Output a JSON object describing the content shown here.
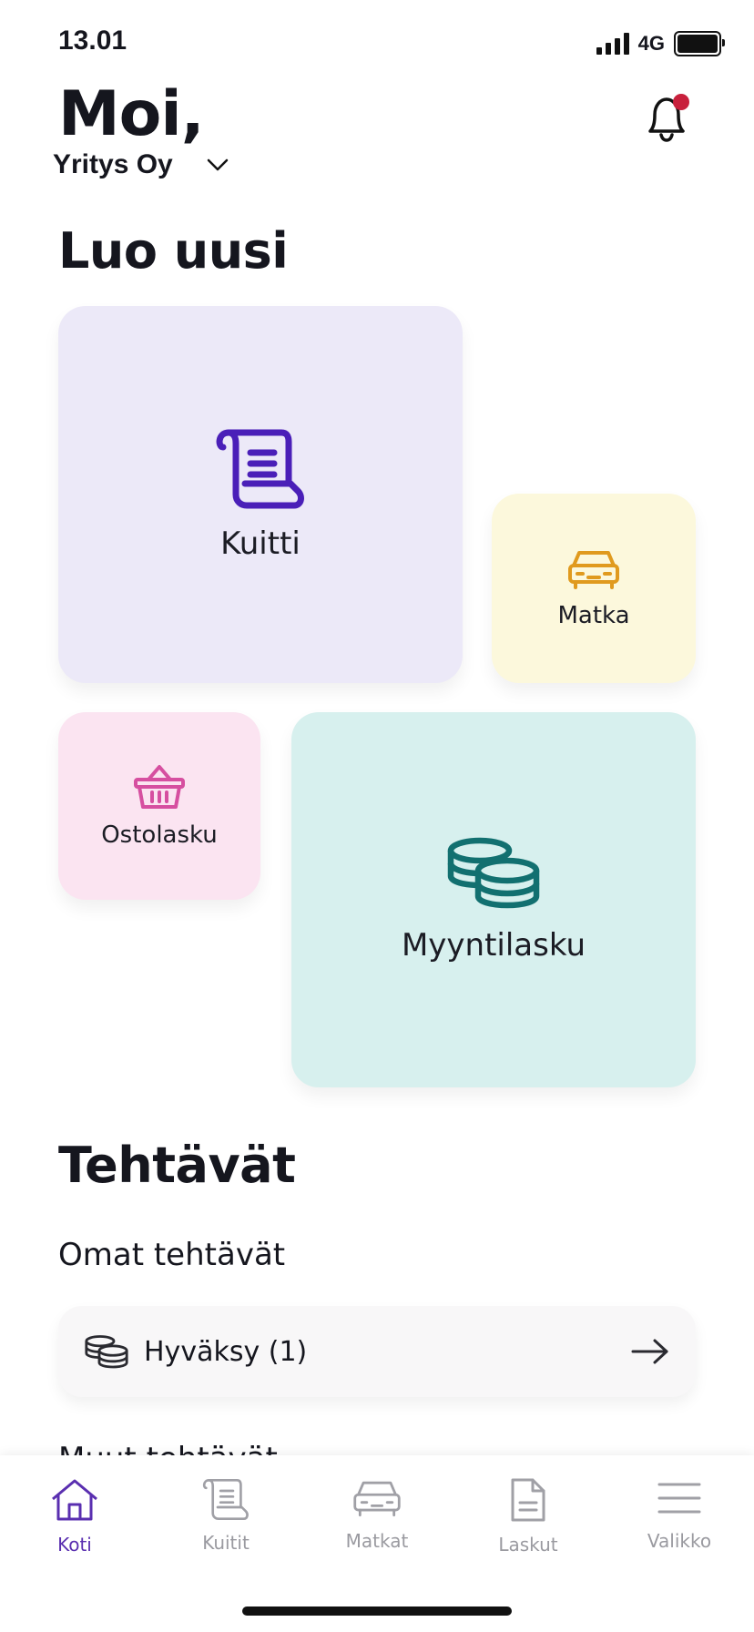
{
  "status_bar": {
    "time": "13.01",
    "network": "4G"
  },
  "header": {
    "greeting": "Moi,",
    "company": "Yritys Oy",
    "company_dropdown_icon": "chevron-down-icon",
    "notification_icon": "bell-icon",
    "notification_badge_color": "#c8203c"
  },
  "create": {
    "title": "Luo uusi",
    "tiles": [
      {
        "label": "Kuitti",
        "icon": "receipt-scroll-icon",
        "bg": "#ece9f8",
        "icon_color": "#4a1fb8"
      },
      {
        "label": "Matka",
        "icon": "car-icon",
        "bg": "#fcf8dc",
        "icon_color": "#e09a1e"
      },
      {
        "label": "Ostolasku",
        "icon": "basket-icon",
        "bg": "#fbe4f1",
        "icon_color": "#d64fa0"
      },
      {
        "label": "Myyntilasku",
        "icon": "coins-icon",
        "bg": "#d7f0ee",
        "icon_color": "#127070"
      }
    ]
  },
  "tasks": {
    "title": "Tehtävät",
    "own_title": "Omat tehtävät",
    "items": [
      {
        "label": "Hyväksy (1)",
        "icon": "coins-icon",
        "action_icon": "arrow-right-icon"
      }
    ],
    "peek_text": "Muut tehtävät"
  },
  "bottom_nav": {
    "active_color": "#5a2fb0",
    "items": [
      {
        "label": "Koti",
        "icon": "home-icon",
        "active": true
      },
      {
        "label": "Kuitit",
        "icon": "receipt-scroll-icon",
        "active": false
      },
      {
        "label": "Matkat",
        "icon": "car-icon",
        "active": false
      },
      {
        "label": "Laskut",
        "icon": "document-icon",
        "active": false
      },
      {
        "label": "Valikko",
        "icon": "menu-icon",
        "active": false
      }
    ]
  }
}
